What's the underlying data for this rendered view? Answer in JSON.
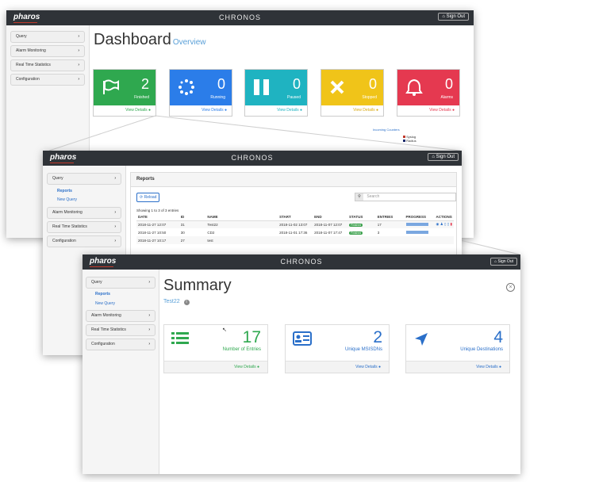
{
  "app": {
    "brand": "pharos",
    "title": "CHRONOS",
    "signout": "Sign Out"
  },
  "sidebar": {
    "query": "Query",
    "reports": "Reports",
    "new_query": "New Query",
    "alarm": "Alarm Monitoring",
    "realtime": "Real Time Statistics",
    "config": "Configuration"
  },
  "dashboard": {
    "title": "Dashboard",
    "subtitle": "Overview",
    "view_details": "View Details",
    "tiles": [
      {
        "value": "2",
        "label": "Finished",
        "color": "#2fa84f"
      },
      {
        "value": "0",
        "label": "Running",
        "color": "#2b7de9"
      },
      {
        "value": "0",
        "label": "Paused",
        "color": "#1fb3c1"
      },
      {
        "value": "0",
        "label": "Stopped",
        "color": "#f0c419"
      },
      {
        "value": "0",
        "label": "Alarms",
        "color": "#e53950"
      }
    ],
    "incoming_counters": "Incoming Counters",
    "legend": [
      "Syslog",
      "Radius"
    ]
  },
  "reports": {
    "panel_title": "Reports",
    "reload": "Reload",
    "search_placeholder": "Search",
    "showing": "Showing 1 to 3 of 3 entries",
    "columns": [
      "DATE",
      "ID",
      "NAME",
      "START",
      "END",
      "STATUS",
      "ENTRIES",
      "PROGRESS",
      "ACTIONS"
    ],
    "rows": [
      {
        "date": "2018-11-27 12:07",
        "id": "31",
        "name": "Test22",
        "start": "2018-11-02 13:07",
        "end": "2018-11-07 12:07",
        "status": "Finished",
        "entries": "17"
      },
      {
        "date": "2018-11-27 10:50",
        "id": "30",
        "name": "CD2",
        "start": "2018-11-01 17:36",
        "end": "2018-11-07 17:47",
        "status": "Finished",
        "entries": "3"
      },
      {
        "date": "2018-11-27 10:17",
        "id": "27",
        "name": "test",
        "start": "",
        "end": "",
        "status": "",
        "entries": ""
      }
    ]
  },
  "summary": {
    "title": "Summary",
    "report_name": "Test22",
    "view_details": "View Details",
    "cards": [
      {
        "value": "17",
        "label": "Number of Entries",
        "icon": "list-icon"
      },
      {
        "value": "2",
        "label": "Unique MSISDNs",
        "icon": "id-card-icon"
      },
      {
        "value": "4",
        "label": "Unique Destinations",
        "icon": "location-arrow-icon"
      }
    ]
  }
}
